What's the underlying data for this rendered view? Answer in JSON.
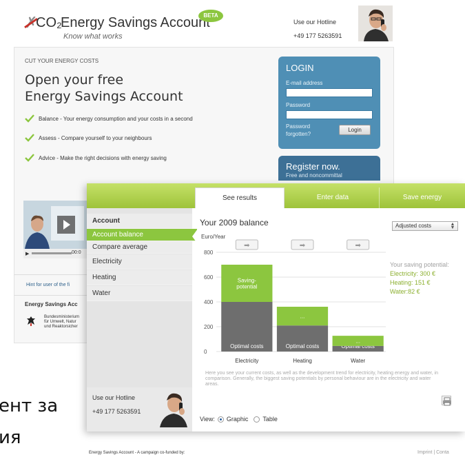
{
  "landing": {
    "logo_co2": "CO₂",
    "title": "Energy Savings Account",
    "tagline": "Know what works",
    "beta": "BETA",
    "hotline_label": "Use our Hotline",
    "hotline_number": "+49 177 5263591",
    "cut_label": "CUT YOUR ENERGY COSTS",
    "headline_1": "Open your free",
    "headline_2": "Energy Savings Account",
    "bullets": [
      "Balance - Your energy consumption and your costs in a second",
      "Assess - Compare yourself to your neighbours",
      "Advice - Make the right decisions with energy saving"
    ],
    "login": {
      "title": "LOGIN",
      "email_label": "E-mail address",
      "password_label": "Password",
      "forgot_1": "Password",
      "forgot_2": "forgotten?",
      "button": "Login"
    },
    "register": {
      "title": "Register now.",
      "subtitle": "Free and noncommittal"
    },
    "video_time": "00:0",
    "hint": "Hint for user of the fi",
    "footer_label": "Energy Savings Acc",
    "ministry_1": "Bundesministerium",
    "ministry_2": "für Umwelt, Natur",
    "ministry_3": "und Reaktorsicher"
  },
  "tabs": [
    {
      "label": "See results",
      "active": true
    },
    {
      "label": "Enter data",
      "active": false
    },
    {
      "label": "Save energy",
      "active": false
    }
  ],
  "sidebar": {
    "items": [
      {
        "label": "Account",
        "kind": "head"
      },
      {
        "label": "Account balance",
        "kind": "sel"
      },
      {
        "label": "Compare average",
        "kind": "normal"
      },
      {
        "label": "Electricity",
        "kind": "normal"
      },
      {
        "label": "Heating",
        "kind": "normal"
      },
      {
        "label": "Water",
        "kind": "normal"
      }
    ],
    "hotline_label": "Use our Hotline",
    "hotline_number": "+49 177 5263591"
  },
  "main": {
    "title": "Your 2009 balance",
    "select_value": "Adjusted costs",
    "unit": "Euro/Year",
    "potential_head": "Your saving potential:",
    "potential_lines": [
      "Electricity: 300 €",
      "Heating: 151 €",
      "Water:82 €"
    ],
    "description": "Here you see your current costs, as well as the development trend for electricity, heating energy and water, in comparison. Generally, the biggest saving potentials by personal behaviour are in the electricity and water areas.",
    "view_label": "View:",
    "view_graphic": "Graphic",
    "view_table": "Table"
  },
  "chart_data": {
    "type": "bar",
    "stacked": true,
    "categories": [
      "Electricity",
      "Heating",
      "Water"
    ],
    "series": [
      {
        "name": "Optimal costs",
        "values": [
          400,
          210,
          45
        ],
        "color": "#6e6e6e"
      },
      {
        "name": "Saving-potential",
        "values": [
          300,
          151,
          82
        ],
        "color": "#8cc63f"
      }
    ],
    "segment_labels": [
      [
        "Optimal costs",
        "Optimal costs",
        "Optimal costs"
      ],
      [
        "Saving-potential",
        "...",
        "..."
      ]
    ],
    "ylim": [
      0,
      800
    ],
    "yticks": [
      0,
      200,
      400,
      600,
      800
    ],
    "ylabel": "Euro/Year"
  },
  "footer": {
    "left": "Energy Savings Account - A campaign co-funded by:",
    "right": "Imprint  |  Conta"
  },
  "overlay": {
    "line1": "ент за",
    "line2": "ия"
  },
  "colors": {
    "green": "#8cc63f",
    "blue": "#4f8fb5",
    "dark_blue": "#3d7096",
    "bar_gray": "#6e6e6e"
  }
}
